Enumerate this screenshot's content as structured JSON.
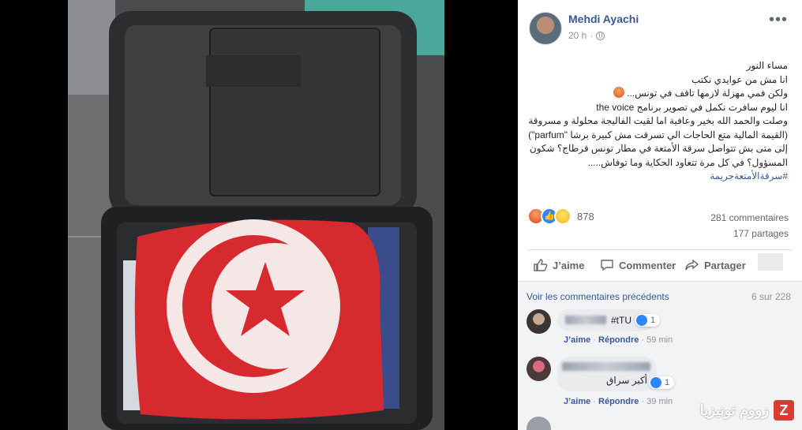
{
  "post": {
    "author": "Mehdi Ayachi",
    "time": "20 h",
    "more_label": "•••",
    "lines": [
      "مساء النور",
      "انا مش من عوايدي نكتب",
      "ولكن فمي مهزلة لازمها تاقف في تونس...",
      "انا ليوم سافرت نكمل في تصوير برنامج the voice",
      "وصلت والحمد الله بخير وعافية اما لقيت الفاليجة محلولة و مسروقة (القيمة المالية متع الحاجات الي تسرقت مش كبيرة برشا \"parfum\") إلى متى بش تتواصل سرقة الأمتعة في مطار تونس قرطاج؟ شكون المسؤول؟ في كل مرة تتعاود الحكاية وما توفاش....."
    ],
    "hashtag": "#سرقةالأمتعةجريمة",
    "reactions_count": "878",
    "comments_count": "281 commentaires",
    "shares_count": "177 partages"
  },
  "actions": {
    "like": "J’aime",
    "comment": "Commenter",
    "share": "Partager"
  },
  "comments": {
    "prev_link": "Voir les commentaires précédents",
    "count": "6 sur 228",
    "items": [
      {
        "text": "#tTU",
        "likes": "1",
        "like_label": "J’aime",
        "reply_label": "Répondre",
        "time": "59 min"
      },
      {
        "text": "أكبر سراق",
        "likes": "1",
        "like_label": "J’aime",
        "reply_label": "Répondre",
        "time": "39 min"
      }
    ]
  },
  "watermark": {
    "text": "زووم تونيزيا",
    "logo": "Z"
  },
  "colors": {
    "link": "#385898",
    "like_blue": "#2d88ff",
    "flag_red": "#d62a2f"
  }
}
